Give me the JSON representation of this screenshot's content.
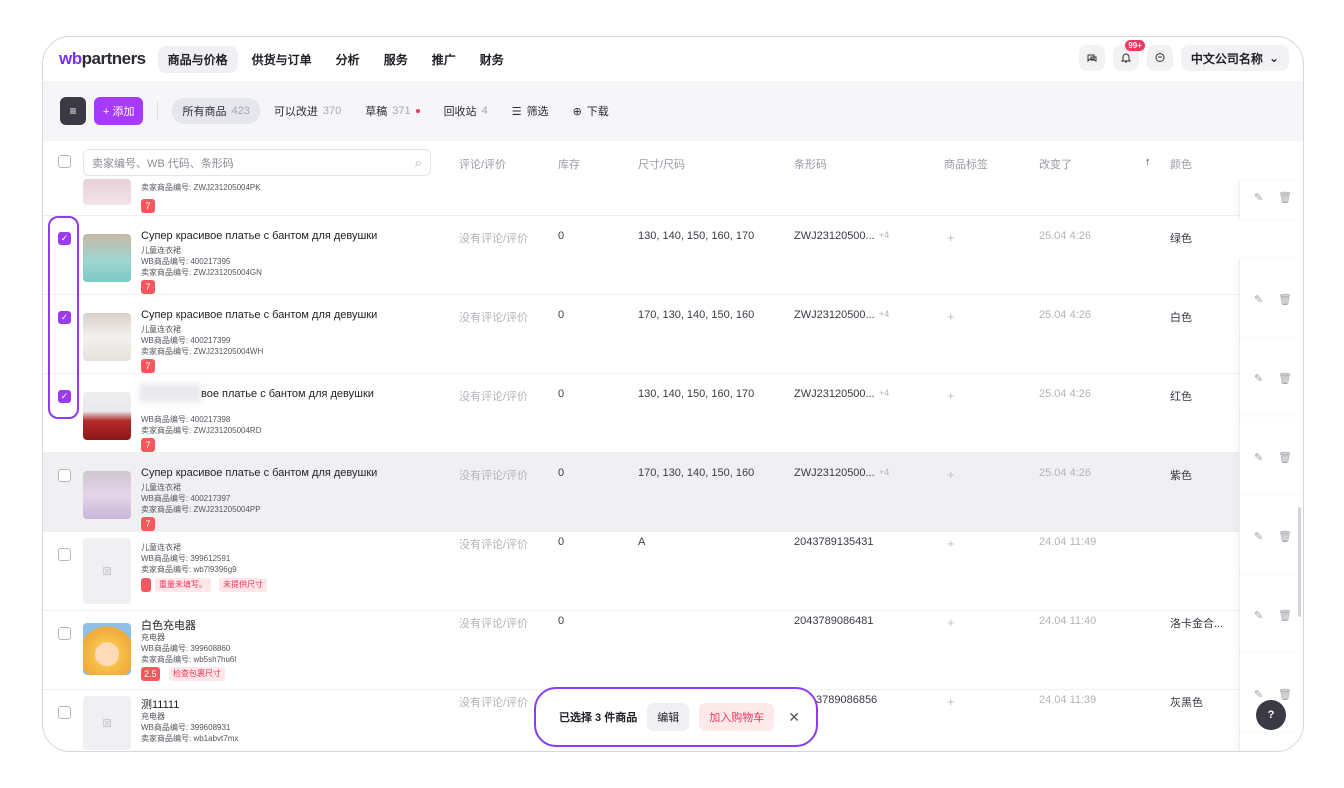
{
  "nav": {
    "logo_wb": "wb",
    "logo_rest": "partners",
    "tabs": [
      "商品与价格",
      "供货与订单",
      "分析",
      "服务",
      "推广",
      "财务"
    ],
    "notif_badge": "99+",
    "company": "中文公司名称"
  },
  "toolbar": {
    "add_label": "+ 添加",
    "filter_tabs": [
      {
        "label": "所有商品",
        "count": "423"
      },
      {
        "label": "可以改进",
        "count": "370"
      },
      {
        "label": "草稿",
        "count": "371"
      },
      {
        "label": "回收站",
        "count": "4"
      }
    ],
    "filter_label": "筛选",
    "download_label": "下载"
  },
  "table": {
    "search_placeholder": "卖家编号、WB 代码、条形码",
    "headers": {
      "reviews": "评论/评价",
      "stock": "库存",
      "sizes": "尺寸/尺码",
      "barcode": "条形码",
      "labels": "商品标签",
      "changed": "改变了",
      "sort_arrow": "↑",
      "color": "颜色"
    },
    "partial_row": {
      "line1": "卖家商品编号: ZWJ231205004PK",
      "tag": "7"
    },
    "rows": [
      {
        "name": "Супер красивое платье с бантом для девушки",
        "category": "儿童连衣裙",
        "wb_id": "WB商品编号: 400217395",
        "seller_id": "卖家商品编号: ZWJ231205004GN",
        "tag": "7",
        "reviews": "没有评论/评价",
        "stock": "0",
        "sizes": "130, 140, 150, 160, 170",
        "barcode": "ZWJ23120500...",
        "barcode_more": "+4",
        "label": "+",
        "date": "25.04 4:26",
        "color": "绿色",
        "checked": true
      },
      {
        "name": "Супер красивое платье с бантом для девушки",
        "category": "儿童连衣裙",
        "wb_id": "WB商品编号: 400217399",
        "seller_id": "卖家商品编号: ZWJ231205004WH",
        "tag": "7",
        "reviews": "没有评论/评价",
        "stock": "0",
        "sizes": "170, 130, 140, 150, 160",
        "barcode": "ZWJ23120500...",
        "barcode_more": "+4",
        "label": "+",
        "date": "25.04 4:26",
        "color": "白色",
        "checked": true
      },
      {
        "name": "вое платье с бантом для девушки",
        "category": "",
        "wb_id": "WB商品编号: 400217398",
        "seller_id": "卖家商品编号: ZWJ231205004RD",
        "tag": "7",
        "reviews": "没有评论/评价",
        "stock": "0",
        "sizes": "130, 140, 150, 160, 170",
        "barcode": "ZWJ23120500...",
        "barcode_more": "+4",
        "label": "+",
        "date": "25.04 4:26",
        "color": "红色",
        "checked": true
      },
      {
        "name": "Супер красивое платье с бантом для девушки",
        "category": "儿童连衣裙",
        "wb_id": "WB商品编号: 400217397",
        "seller_id": "卖家商品编号: ZWJ231205004PP",
        "tag": "7",
        "reviews": "没有评论/评价",
        "stock": "0",
        "sizes": "170, 130, 140, 150, 160",
        "barcode": "ZWJ23120500...",
        "barcode_more": "+4",
        "label": "+",
        "date": "25.04 4:26",
        "color": "紫色",
        "checked": false
      },
      {
        "name": "",
        "category": "儿童连衣裙",
        "wb_id": "WB商品编号: 399612591",
        "seller_id": "卖家商品编号: wb7l9396g9",
        "tag": "",
        "warn1": "重量未填写。",
        "warn2": "未提供尺寸",
        "reviews": "没有评论/评价",
        "stock": "0",
        "sizes": "A",
        "barcode": "2043789135431",
        "barcode_more": "",
        "label": "+",
        "date": "24.04 11:49",
        "color": "",
        "checked": false
      },
      {
        "name": "白色充电器",
        "category": "充电器",
        "wb_id": "WB商品编号: 399608860",
        "seller_id": "卖家商品编号: wb5sh7hu6l",
        "tag": "2.5",
        "warn1": "检查包裹尺寸",
        "reviews": "没有评论/评价",
        "stock": "0",
        "sizes": "",
        "barcode": "2043789086481",
        "barcode_more": "",
        "label": "+",
        "date": "24.04 11:40",
        "color": "洛卡金合...",
        "checked": false
      },
      {
        "name": "测11111",
        "category": "充电器",
        "wb_id": "WB商品编号: 399608931",
        "seller_id": "卖家商品编号: wb1abvt7mx",
        "tag": "",
        "reviews": "没有评论/评价",
        "stock": "",
        "sizes": "",
        "barcode": "3789086856",
        "barcode_more": "",
        "label": "+",
        "date": "24.04 11:39",
        "color": "灰黑色",
        "checked": false
      }
    ]
  },
  "bulk": {
    "selected_text": "已选择 3 件商品",
    "edit_label": "编辑",
    "cart_label": "加入购物车"
  },
  "help_label": "?",
  "colors": {
    "accent": "#a73afd",
    "danger": "#f5365c"
  }
}
